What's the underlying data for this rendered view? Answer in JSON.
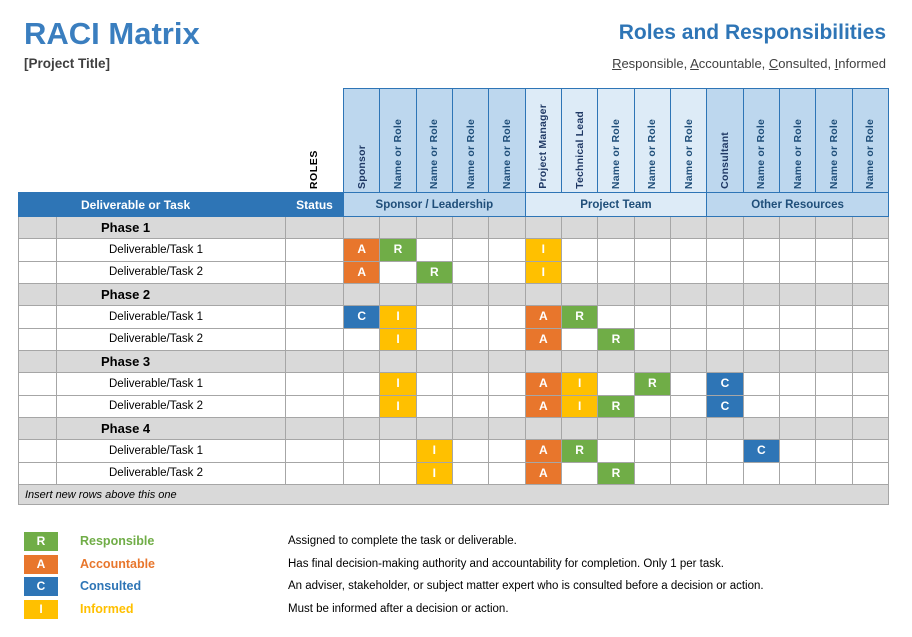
{
  "header": {
    "title": "RACI Matrix",
    "project_title": "[Project Title]",
    "right_title": "Roles and Responsibilities",
    "right_subtitle_parts": [
      {
        "initial": "R",
        "rest": "esponsible, "
      },
      {
        "initial": "A",
        "rest": "ccountable, "
      },
      {
        "initial": "C",
        "rest": "onsulted, "
      },
      {
        "initial": "I",
        "rest": "nformed"
      }
    ]
  },
  "table": {
    "roles_axis_label": "ROLES",
    "deliverable_header": "Deliverable or Task",
    "status_header": "Status",
    "insert_row_text": "Insert new rows above this one",
    "groups": [
      {
        "label": "Sponsor / Leadership",
        "span": 5,
        "shade": "grp-a"
      },
      {
        "label": "Project Team",
        "span": 5,
        "shade": "grp-b"
      },
      {
        "label": "Other Resources",
        "span": 5,
        "shade": "grp-a"
      }
    ],
    "role_columns": [
      {
        "label": "Sponsor",
        "named": true,
        "shade": "grp-a"
      },
      {
        "label": "Name or Role",
        "named": false,
        "shade": "grp-a"
      },
      {
        "label": "Name or Role",
        "named": false,
        "shade": "grp-a"
      },
      {
        "label": "Name or Role",
        "named": false,
        "shade": "grp-a"
      },
      {
        "label": "Name or Role",
        "named": false,
        "shade": "grp-a"
      },
      {
        "label": "Project Manager",
        "named": true,
        "shade": "grp-b"
      },
      {
        "label": "Technical Lead",
        "named": true,
        "shade": "grp-b"
      },
      {
        "label": "Name or Role",
        "named": false,
        "shade": "grp-b"
      },
      {
        "label": "Name or Role",
        "named": false,
        "shade": "grp-b"
      },
      {
        "label": "Name or Role",
        "named": false,
        "shade": "grp-b"
      },
      {
        "label": "Consultant",
        "named": true,
        "shade": "grp-a"
      },
      {
        "label": "Name or Role",
        "named": false,
        "shade": "grp-a"
      },
      {
        "label": "Name or Role",
        "named": false,
        "shade": "grp-a"
      },
      {
        "label": "Name or Role",
        "named": false,
        "shade": "grp-a"
      },
      {
        "label": "Name or Role",
        "named": false,
        "shade": "grp-a"
      }
    ],
    "sections": [
      {
        "phase": "Phase 1",
        "tasks": [
          {
            "name": "Deliverable/Task 1",
            "status": "",
            "marks": [
              "A",
              "R",
              "",
              "",
              "",
              "I",
              "",
              "",
              "",
              "",
              "",
              "",
              "",
              "",
              ""
            ]
          },
          {
            "name": "Deliverable/Task 2",
            "status": "",
            "marks": [
              "A",
              "",
              "R",
              "",
              "",
              "I",
              "",
              "",
              "",
              "",
              "",
              "",
              "",
              "",
              ""
            ]
          }
        ]
      },
      {
        "phase": "Phase 2",
        "tasks": [
          {
            "name": "Deliverable/Task 1",
            "status": "",
            "marks": [
              "C",
              "I",
              "",
              "",
              "",
              "A",
              "R",
              "",
              "",
              "",
              "",
              "",
              "",
              "",
              ""
            ]
          },
          {
            "name": "Deliverable/Task 2",
            "status": "",
            "marks": [
              "",
              "I",
              "",
              "",
              "",
              "A",
              "",
              "R",
              "",
              "",
              "",
              "",
              "",
              "",
              ""
            ]
          }
        ]
      },
      {
        "phase": "Phase 3",
        "tasks": [
          {
            "name": "Deliverable/Task 1",
            "status": "",
            "marks": [
              "",
              "I",
              "",
              "",
              "",
              "A",
              "I",
              "",
              "R",
              "",
              "C",
              "",
              "",
              "",
              ""
            ]
          },
          {
            "name": "Deliverable/Task 2",
            "status": "",
            "marks": [
              "",
              "I",
              "",
              "",
              "",
              "A",
              "I",
              "R",
              "",
              "",
              "C",
              "",
              "",
              "",
              ""
            ]
          }
        ]
      },
      {
        "phase": "Phase 4",
        "tasks": [
          {
            "name": "Deliverable/Task 1",
            "status": "",
            "marks": [
              "",
              "",
              "I",
              "",
              "",
              "A",
              "R",
              "",
              "",
              "",
              "",
              "C",
              "",
              "",
              ""
            ]
          },
          {
            "name": "Deliverable/Task 2",
            "status": "",
            "marks": [
              "",
              "",
              "I",
              "",
              "",
              "A",
              "",
              "R",
              "",
              "",
              "",
              "",
              "",
              "",
              ""
            ]
          }
        ]
      }
    ]
  },
  "legend": [
    {
      "code": "R",
      "label": "Responsible",
      "color": "#70AD47",
      "description": "Assigned to complete the task or deliverable."
    },
    {
      "code": "A",
      "label": "Accountable",
      "color": "#E8762C",
      "description": "Has final decision-making authority and accountability for completion. Only 1 per task."
    },
    {
      "code": "C",
      "label": "Consulted",
      "color": "#2E75B6",
      "description": "An adviser, stakeholder, or subject matter expert who is consulted before a decision or action."
    },
    {
      "code": "I",
      "label": "Informed",
      "color": "#FFC000",
      "description": "Must be informed after a decision or action."
    }
  ]
}
